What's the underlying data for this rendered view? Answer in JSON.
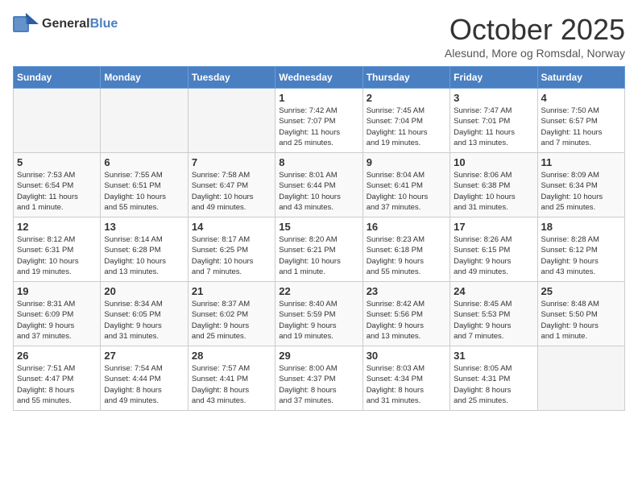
{
  "logo": {
    "general": "General",
    "blue": "Blue"
  },
  "header": {
    "title": "October 2025",
    "subtitle": "Alesund, More og Romsdal, Norway"
  },
  "days_of_week": [
    "Sunday",
    "Monday",
    "Tuesday",
    "Wednesday",
    "Thursday",
    "Friday",
    "Saturday"
  ],
  "weeks": [
    [
      {
        "day": "",
        "info": ""
      },
      {
        "day": "",
        "info": ""
      },
      {
        "day": "",
        "info": ""
      },
      {
        "day": "1",
        "info": "Sunrise: 7:42 AM\nSunset: 7:07 PM\nDaylight: 11 hours\nand 25 minutes."
      },
      {
        "day": "2",
        "info": "Sunrise: 7:45 AM\nSunset: 7:04 PM\nDaylight: 11 hours\nand 19 minutes."
      },
      {
        "day": "3",
        "info": "Sunrise: 7:47 AM\nSunset: 7:01 PM\nDaylight: 11 hours\nand 13 minutes."
      },
      {
        "day": "4",
        "info": "Sunrise: 7:50 AM\nSunset: 6:57 PM\nDaylight: 11 hours\nand 7 minutes."
      }
    ],
    [
      {
        "day": "5",
        "info": "Sunrise: 7:53 AM\nSunset: 6:54 PM\nDaylight: 11 hours\nand 1 minute."
      },
      {
        "day": "6",
        "info": "Sunrise: 7:55 AM\nSunset: 6:51 PM\nDaylight: 10 hours\nand 55 minutes."
      },
      {
        "day": "7",
        "info": "Sunrise: 7:58 AM\nSunset: 6:47 PM\nDaylight: 10 hours\nand 49 minutes."
      },
      {
        "day": "8",
        "info": "Sunrise: 8:01 AM\nSunset: 6:44 PM\nDaylight: 10 hours\nand 43 minutes."
      },
      {
        "day": "9",
        "info": "Sunrise: 8:04 AM\nSunset: 6:41 PM\nDaylight: 10 hours\nand 37 minutes."
      },
      {
        "day": "10",
        "info": "Sunrise: 8:06 AM\nSunset: 6:38 PM\nDaylight: 10 hours\nand 31 minutes."
      },
      {
        "day": "11",
        "info": "Sunrise: 8:09 AM\nSunset: 6:34 PM\nDaylight: 10 hours\nand 25 minutes."
      }
    ],
    [
      {
        "day": "12",
        "info": "Sunrise: 8:12 AM\nSunset: 6:31 PM\nDaylight: 10 hours\nand 19 minutes."
      },
      {
        "day": "13",
        "info": "Sunrise: 8:14 AM\nSunset: 6:28 PM\nDaylight: 10 hours\nand 13 minutes."
      },
      {
        "day": "14",
        "info": "Sunrise: 8:17 AM\nSunset: 6:25 PM\nDaylight: 10 hours\nand 7 minutes."
      },
      {
        "day": "15",
        "info": "Sunrise: 8:20 AM\nSunset: 6:21 PM\nDaylight: 10 hours\nand 1 minute."
      },
      {
        "day": "16",
        "info": "Sunrise: 8:23 AM\nSunset: 6:18 PM\nDaylight: 9 hours\nand 55 minutes."
      },
      {
        "day": "17",
        "info": "Sunrise: 8:26 AM\nSunset: 6:15 PM\nDaylight: 9 hours\nand 49 minutes."
      },
      {
        "day": "18",
        "info": "Sunrise: 8:28 AM\nSunset: 6:12 PM\nDaylight: 9 hours\nand 43 minutes."
      }
    ],
    [
      {
        "day": "19",
        "info": "Sunrise: 8:31 AM\nSunset: 6:09 PM\nDaylight: 9 hours\nand 37 minutes."
      },
      {
        "day": "20",
        "info": "Sunrise: 8:34 AM\nSunset: 6:05 PM\nDaylight: 9 hours\nand 31 minutes."
      },
      {
        "day": "21",
        "info": "Sunrise: 8:37 AM\nSunset: 6:02 PM\nDaylight: 9 hours\nand 25 minutes."
      },
      {
        "day": "22",
        "info": "Sunrise: 8:40 AM\nSunset: 5:59 PM\nDaylight: 9 hours\nand 19 minutes."
      },
      {
        "day": "23",
        "info": "Sunrise: 8:42 AM\nSunset: 5:56 PM\nDaylight: 9 hours\nand 13 minutes."
      },
      {
        "day": "24",
        "info": "Sunrise: 8:45 AM\nSunset: 5:53 PM\nDaylight: 9 hours\nand 7 minutes."
      },
      {
        "day": "25",
        "info": "Sunrise: 8:48 AM\nSunset: 5:50 PM\nDaylight: 9 hours\nand 1 minute."
      }
    ],
    [
      {
        "day": "26",
        "info": "Sunrise: 7:51 AM\nSunset: 4:47 PM\nDaylight: 8 hours\nand 55 minutes."
      },
      {
        "day": "27",
        "info": "Sunrise: 7:54 AM\nSunset: 4:44 PM\nDaylight: 8 hours\nand 49 minutes."
      },
      {
        "day": "28",
        "info": "Sunrise: 7:57 AM\nSunset: 4:41 PM\nDaylight: 8 hours\nand 43 minutes."
      },
      {
        "day": "29",
        "info": "Sunrise: 8:00 AM\nSunset: 4:37 PM\nDaylight: 8 hours\nand 37 minutes."
      },
      {
        "day": "30",
        "info": "Sunrise: 8:03 AM\nSunset: 4:34 PM\nDaylight: 8 hours\nand 31 minutes."
      },
      {
        "day": "31",
        "info": "Sunrise: 8:05 AM\nSunset: 4:31 PM\nDaylight: 8 hours\nand 25 minutes."
      },
      {
        "day": "",
        "info": ""
      }
    ]
  ]
}
